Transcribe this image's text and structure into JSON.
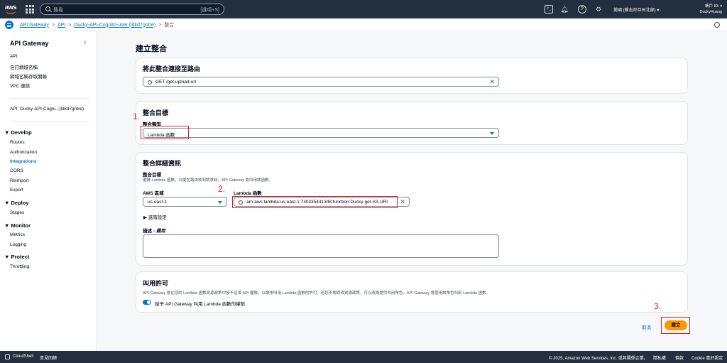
{
  "topnav": {
    "search_placeholder": "搜尋",
    "search_shortcut": "[選項+S]",
    "region": "美國 (維吉尼亞州北部) ▾",
    "account_id": "帳戶 ID: ▾",
    "account_user": "DuckyHuang"
  },
  "breadcrumb": {
    "items": [
      "API Gateway",
      "API",
      "Ducky-API-Cognito-user (ldkd7gntre)"
    ],
    "current": "整合",
    "sep": ">"
  },
  "sidebar": {
    "title": "API Gateway",
    "top_items": [
      "API",
      "自訂網域名稱",
      "網域名稱存取關聯",
      "VPC 連結"
    ],
    "api_label": "API: Ducky-API-Cogni...(ldkd7gntre)",
    "sections": [
      {
        "title": "Develop",
        "items": [
          "Routes",
          "Authorization",
          "Integrations",
          "CORS",
          "Reimport",
          "Export"
        ]
      },
      {
        "title": "Deploy",
        "items": [
          "Stages"
        ]
      },
      {
        "title": "Monitor",
        "items": [
          "Metrics",
          "Logging"
        ]
      },
      {
        "title": "Protect",
        "items": [
          "Throttling"
        ]
      }
    ],
    "active_item": "Integrations"
  },
  "main": {
    "page_title": "建立整合",
    "route_card": {
      "title": "將此整合連接至路由",
      "value": "GET /get-upload-url"
    },
    "target_card": {
      "title": "整合目標",
      "type_label": "整合類型",
      "type_value": "Lambda 函數"
    },
    "details_card": {
      "title": "整合詳細資訊",
      "target_label": "整合目標",
      "target_desc": "選擇 Lambda 函數，以便在路由收到請求時，API Gateway 會叫用該函數。",
      "region_label": "AWS 區域",
      "region_value": "us-east-1",
      "lambda_label": "Lambda 函數",
      "lambda_value": "arn:aws:lambda:us-east-1:730335441348:function:Ducky-get-S3-URI",
      "advanced": "▶  進階設定",
      "desc_label": "描述 - ",
      "desc_optional": "選用"
    },
    "permission_card": {
      "title": "叫用許可",
      "desc": "API Gateway 會在您的 Lambda 函數資源政策中授予這項 API 權限，以讓求叫用 Lambda 函數的許可。若您不想修改資源政策，可以改為提供叫用角色。API Gateway 會使用該角色叫用 Lambda 函數。",
      "toggle_label": "授予 API Gateway 叫用 Lambda 函數的權限"
    },
    "cancel": "取消",
    "create": "建立",
    "annotations": [
      "1.",
      "2.",
      "3."
    ]
  },
  "footer": {
    "cloudshell": "CloudShell",
    "feedback": "意見回饋",
    "copyright": "© 2025, Amazon Web Services, Inc. 或其關係企業。",
    "privacy": "隱私權",
    "terms": "條款",
    "cookie": "Cookie 喜好設定"
  },
  "colors": {
    "nav_bg": "#232f3e",
    "link": "#0972d3",
    "primary": "#ff9900",
    "annotation": "#e02020"
  }
}
